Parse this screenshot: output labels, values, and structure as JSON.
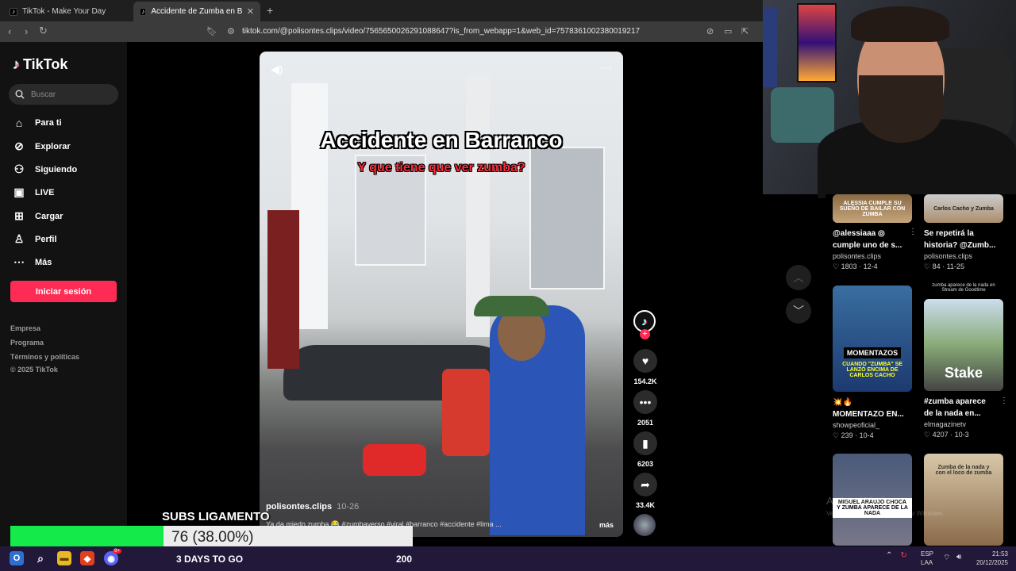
{
  "browser": {
    "tabs": [
      {
        "label": "TikTok - Make Your Day",
        "active": false
      },
      {
        "label": "Accidente de Zumba en Barranc",
        "active": true
      }
    ],
    "new_tab": "+",
    "url": "tiktok.com/@polisontes.clips/video/7565650026291088647?is_from_webapp=1&web_id=7578361002380019217"
  },
  "sidebar": {
    "logo": "TikTok",
    "search_placeholder": "Buscar",
    "nav": [
      {
        "label": "Para ti",
        "icon": "home-icon"
      },
      {
        "label": "Explorar",
        "icon": "compass-icon"
      },
      {
        "label": "Siguiendo",
        "icon": "following-icon"
      },
      {
        "label": "LIVE",
        "icon": "live-icon"
      },
      {
        "label": "Cargar",
        "icon": "upload-icon"
      },
      {
        "label": "Perfil",
        "icon": "profile-icon"
      },
      {
        "label": "Más",
        "icon": "more-icon"
      }
    ],
    "login_button": "Iniciar sesión",
    "footer": [
      "Empresa",
      "Programa",
      "Términos y políticas",
      "© 2025 TikTok"
    ]
  },
  "video": {
    "title": "Accidente en Barranco",
    "subtitle": "Y que tiene que ver zumba?",
    "author": "polisontes.clips",
    "date": "10-26",
    "caption": "Ya da miedo zumba 😂 #zumbaverso #viral #barranco #accidente #lima ...",
    "more": "más"
  },
  "actions": {
    "likes": "154.2K",
    "comments": "2051",
    "saves": "6203",
    "shares": "33.4K"
  },
  "recommendations": [
    {
      "title_line1": "@alessiaaa ◎",
      "title_line2": "cumple uno de s...",
      "author": "polisontes.clips",
      "likes": "1803",
      "date": "12-4",
      "thumb_text": "ALESSIA CUMPLE SU SUEÑO DE BAILAR CON ZUMBA"
    },
    {
      "title_line1": "Se repetirá la",
      "title_line2": "historia? @Zumb...",
      "author": "polisontes.clips",
      "likes": "84",
      "date": "11-25",
      "thumb_text": "Carlos Cacho y Zumba"
    },
    {
      "title_line1": "💥🔥",
      "title_line2": "MOMENTAZO EN...",
      "author": "showpeoficial_",
      "likes": "239",
      "date": "10-4",
      "thumb_text": "MOMENTAZOS",
      "thumb_sub": "CUANDO \"ZUMBA\" SE LANZÓ ENCIMA DE CARLOS CACHO"
    },
    {
      "title_line1": "#zumba aparece",
      "title_line2": "de la nada en...",
      "author": "elmagazinetv",
      "likes": "4207",
      "date": "10-3",
      "thumb_text": "Stake",
      "thumb_top": "zumba aparece de la nada en Stream de Goodtime"
    },
    {
      "thumb_text": "MIGUEL ARAUJO CHOCA Y ZUMBA APARECE DE LA NADA"
    },
    {
      "thumb_text": "Zumba de la nada y con el loco de zumba"
    }
  ],
  "watermark": {
    "line1": "Activar Windows",
    "line2": "Ve a Configuración para activar Windows."
  },
  "overlay": {
    "subs_label": "SUBS LIGAMENTO",
    "subs_value": "76 (38.00%)",
    "subs_progress": 0.38,
    "days_to_go": "3 DAYS TO GO",
    "count": "200"
  },
  "taskbar": {
    "lang_line1": "ESP",
    "lang_line2": "LAA",
    "time": "21:53",
    "date": "20/12/2025",
    "badge": "9+"
  },
  "colors": {
    "tiktok_red": "#fe2c55",
    "progress_green": "#14ea4a",
    "taskbar": "#22183a"
  }
}
